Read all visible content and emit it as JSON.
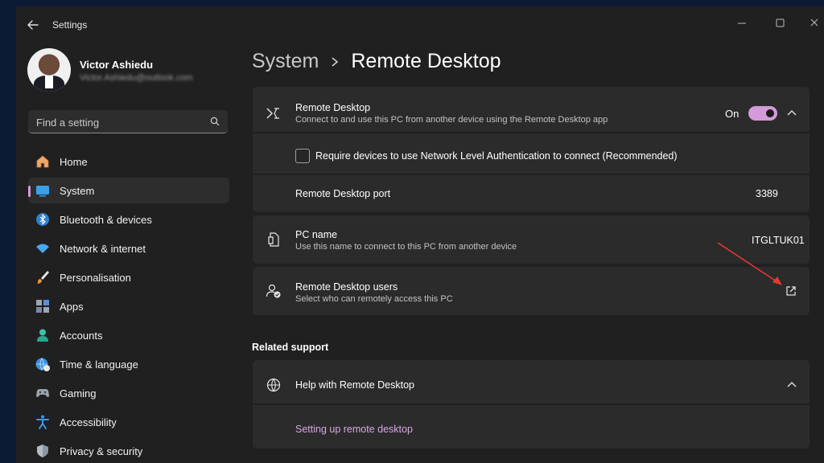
{
  "window": {
    "title": "Settings"
  },
  "user": {
    "name": "Victor Ashiedu",
    "email": "Victor.Ashiedu@outlook.com"
  },
  "search": {
    "placeholder": "Find a setting"
  },
  "nav": [
    {
      "label": "Home",
      "icon": "home-icon",
      "active": false
    },
    {
      "label": "System",
      "icon": "system-icon",
      "active": true
    },
    {
      "label": "Bluetooth & devices",
      "icon": "bluetooth-icon",
      "active": false
    },
    {
      "label": "Network & internet",
      "icon": "wifi-icon",
      "active": false
    },
    {
      "label": "Personalisation",
      "icon": "brush-icon",
      "active": false
    },
    {
      "label": "Apps",
      "icon": "apps-icon",
      "active": false
    },
    {
      "label": "Accounts",
      "icon": "accounts-icon",
      "active": false
    },
    {
      "label": "Time & language",
      "icon": "globe-clock-icon",
      "active": false
    },
    {
      "label": "Gaming",
      "icon": "gamepad-icon",
      "active": false
    },
    {
      "label": "Accessibility",
      "icon": "accessibility-icon",
      "active": false
    },
    {
      "label": "Privacy & security",
      "icon": "shield-icon",
      "active": false
    }
  ],
  "breadcrumb": {
    "parent": "System",
    "current": "Remote Desktop"
  },
  "remote_desktop": {
    "title": "Remote Desktop",
    "subtitle": "Connect to and use this PC from another device using the Remote Desktop app",
    "toggle_label": "On",
    "toggle_on": true,
    "nla_label": "Require devices to use Network Level Authentication to connect (Recommended)",
    "nla_checked": false,
    "port_label": "Remote Desktop port",
    "port_value": "3389"
  },
  "pc_name": {
    "title": "PC name",
    "subtitle": "Use this name to connect to this PC from another device",
    "value": "ITGLTUK01"
  },
  "rd_users": {
    "title": "Remote Desktop users",
    "subtitle": "Select who can remotely access this PC"
  },
  "related": {
    "heading": "Related support",
    "help_title": "Help with Remote Desktop",
    "link": "Setting up remote desktop"
  },
  "colors": {
    "accent": "#d49ad9",
    "background": "#202020",
    "card": "#2b2b2b"
  }
}
